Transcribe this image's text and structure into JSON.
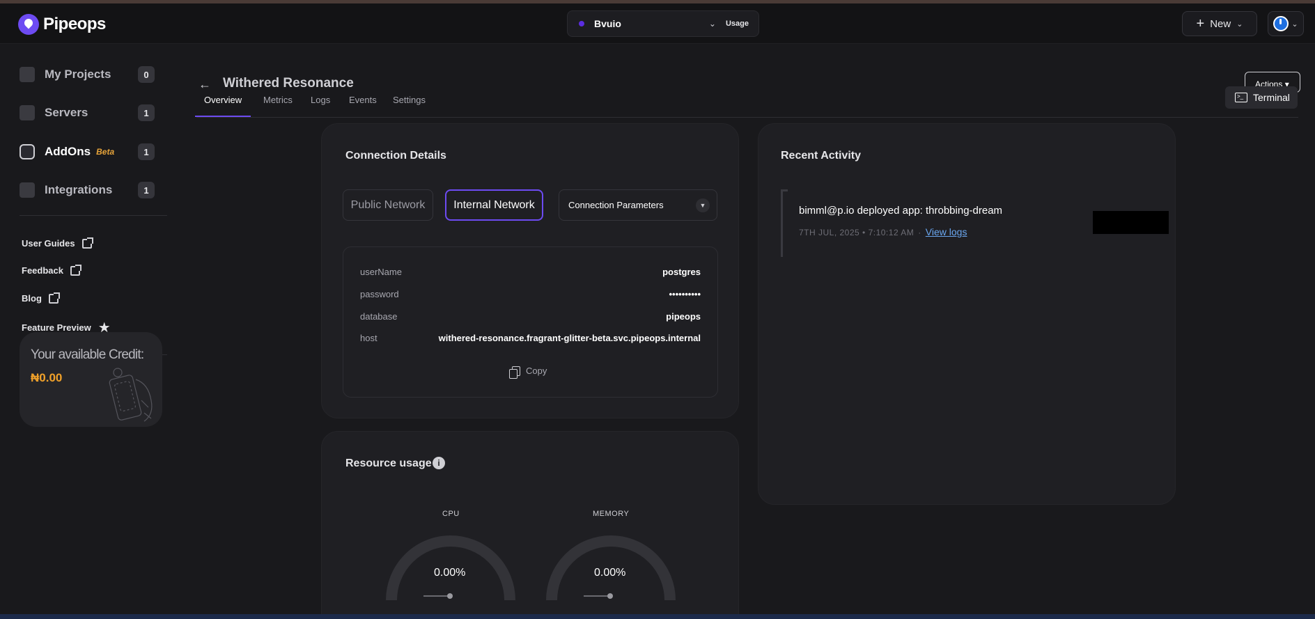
{
  "app": {
    "name": "Pipeops"
  },
  "header": {
    "project": {
      "name": "Bvuio",
      "usage_label": "Usage"
    },
    "new_label": "New"
  },
  "sidebar": {
    "nav": [
      {
        "label": "My Projects",
        "count": "0"
      },
      {
        "label": "Servers",
        "count": "1"
      },
      {
        "label": "AddOns",
        "badge": "Beta",
        "count": "1"
      },
      {
        "label": "Integrations",
        "count": "1"
      }
    ],
    "links": [
      {
        "label": "User Guides"
      },
      {
        "label": "Feedback"
      },
      {
        "label": "Blog"
      },
      {
        "label": "Feature Preview"
      }
    ],
    "credit": {
      "title": "Your available Credit:",
      "amount": "₦0.00"
    }
  },
  "page": {
    "title": "Withered Resonance",
    "actions_label": "Actions",
    "terminal_label": "Terminal",
    "tabs": [
      {
        "label": "Overview",
        "active": true
      },
      {
        "label": "Metrics"
      },
      {
        "label": "Logs"
      },
      {
        "label": "Events"
      },
      {
        "label": "Settings"
      }
    ]
  },
  "connection": {
    "title": "Connection Details",
    "public_label": "Public Network",
    "internal_label": "Internal Network",
    "select_value": "Connection Parameters",
    "params": [
      {
        "key": "userName",
        "value": "postgres"
      },
      {
        "key": "password",
        "value": "••••••••••"
      },
      {
        "key": "database",
        "value": "pipeops"
      },
      {
        "key": "host",
        "value": "withered-resonance.fragrant-glitter-beta.svc.pipeops.internal"
      }
    ],
    "copy_label": "Copy"
  },
  "resources": {
    "title": "Resource usage",
    "gauges": [
      {
        "label": "CPU",
        "value": "0.00%",
        "fraction": 0
      },
      {
        "label": "MEMORY",
        "value": "0.00%",
        "fraction": 0
      }
    ]
  },
  "activity": {
    "title": "Recent Activity",
    "items": [
      {
        "message": "bimml@p.io deployed app: throbbing-dream",
        "timestamp": "7TH JUL, 2025 • 7:10:12 AM",
        "link": "View logs"
      }
    ]
  },
  "colors": {
    "accent": "#6d4bf2",
    "credit": "#f0a12a",
    "link": "#6aa7f0"
  }
}
